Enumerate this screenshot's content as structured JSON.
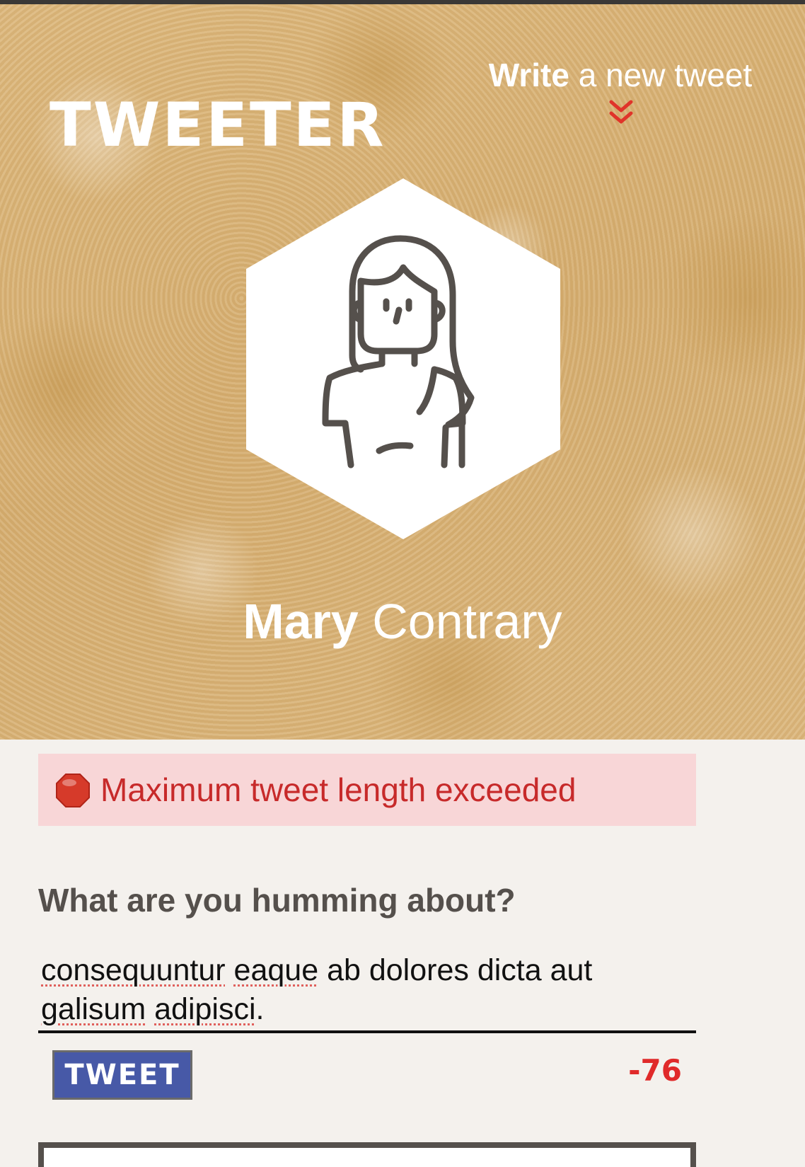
{
  "header": {
    "logo": "TWEETER",
    "write_link_strong": "Write",
    "write_link_rest": " a new tweet",
    "chevron_icon": "double-chevron-down-icon"
  },
  "profile": {
    "first_name": "Mary",
    "last_name": "Contrary",
    "avatar_icon": "woman-avatar-icon"
  },
  "alert": {
    "icon": "stop-sign-icon",
    "message": "Maximum tweet length exceeded"
  },
  "compose": {
    "label": "What are you humming about?",
    "text_line1_word1": "consequuntur",
    "text_line1_word2": "eaque",
    "text_line1_rest": " ab dolores dicta aut",
    "text_line2_word1": "galisum",
    "text_line2_word2": "adipisci",
    "text_line2_end": ".",
    "button_label": "TWEET",
    "counter": "-76"
  },
  "colors": {
    "hero_bg": "#d9b47a",
    "alert_bg": "#f8d6d7",
    "alert_text": "#c72a2a",
    "button_bg": "#4759a7",
    "counter_text": "#e02a2a"
  }
}
